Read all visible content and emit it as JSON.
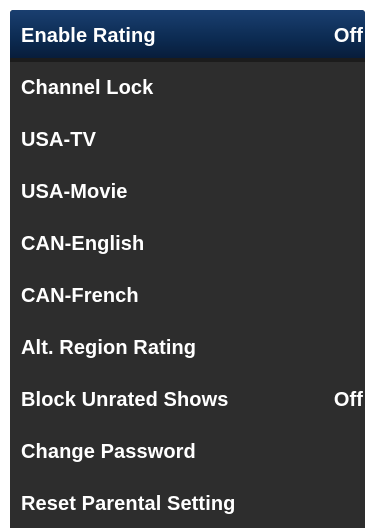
{
  "menu": {
    "items": [
      {
        "label": "Enable Rating",
        "value": "Off",
        "selected": true
      },
      {
        "label": "Channel Lock",
        "value": ""
      },
      {
        "label": "USA-TV",
        "value": ""
      },
      {
        "label": "USA-Movie",
        "value": ""
      },
      {
        "label": "CAN-English",
        "value": ""
      },
      {
        "label": "CAN-French",
        "value": ""
      },
      {
        "label": "Alt. Region Rating",
        "value": ""
      },
      {
        "label": "Block Unrated Shows",
        "value": "Off"
      },
      {
        "label": "Change Password",
        "value": ""
      },
      {
        "label": "Reset Parental Setting",
        "value": ""
      }
    ],
    "colors": {
      "background": "#2d2d2d",
      "highlight": "#0c2b52",
      "text": "#ffffff"
    }
  }
}
